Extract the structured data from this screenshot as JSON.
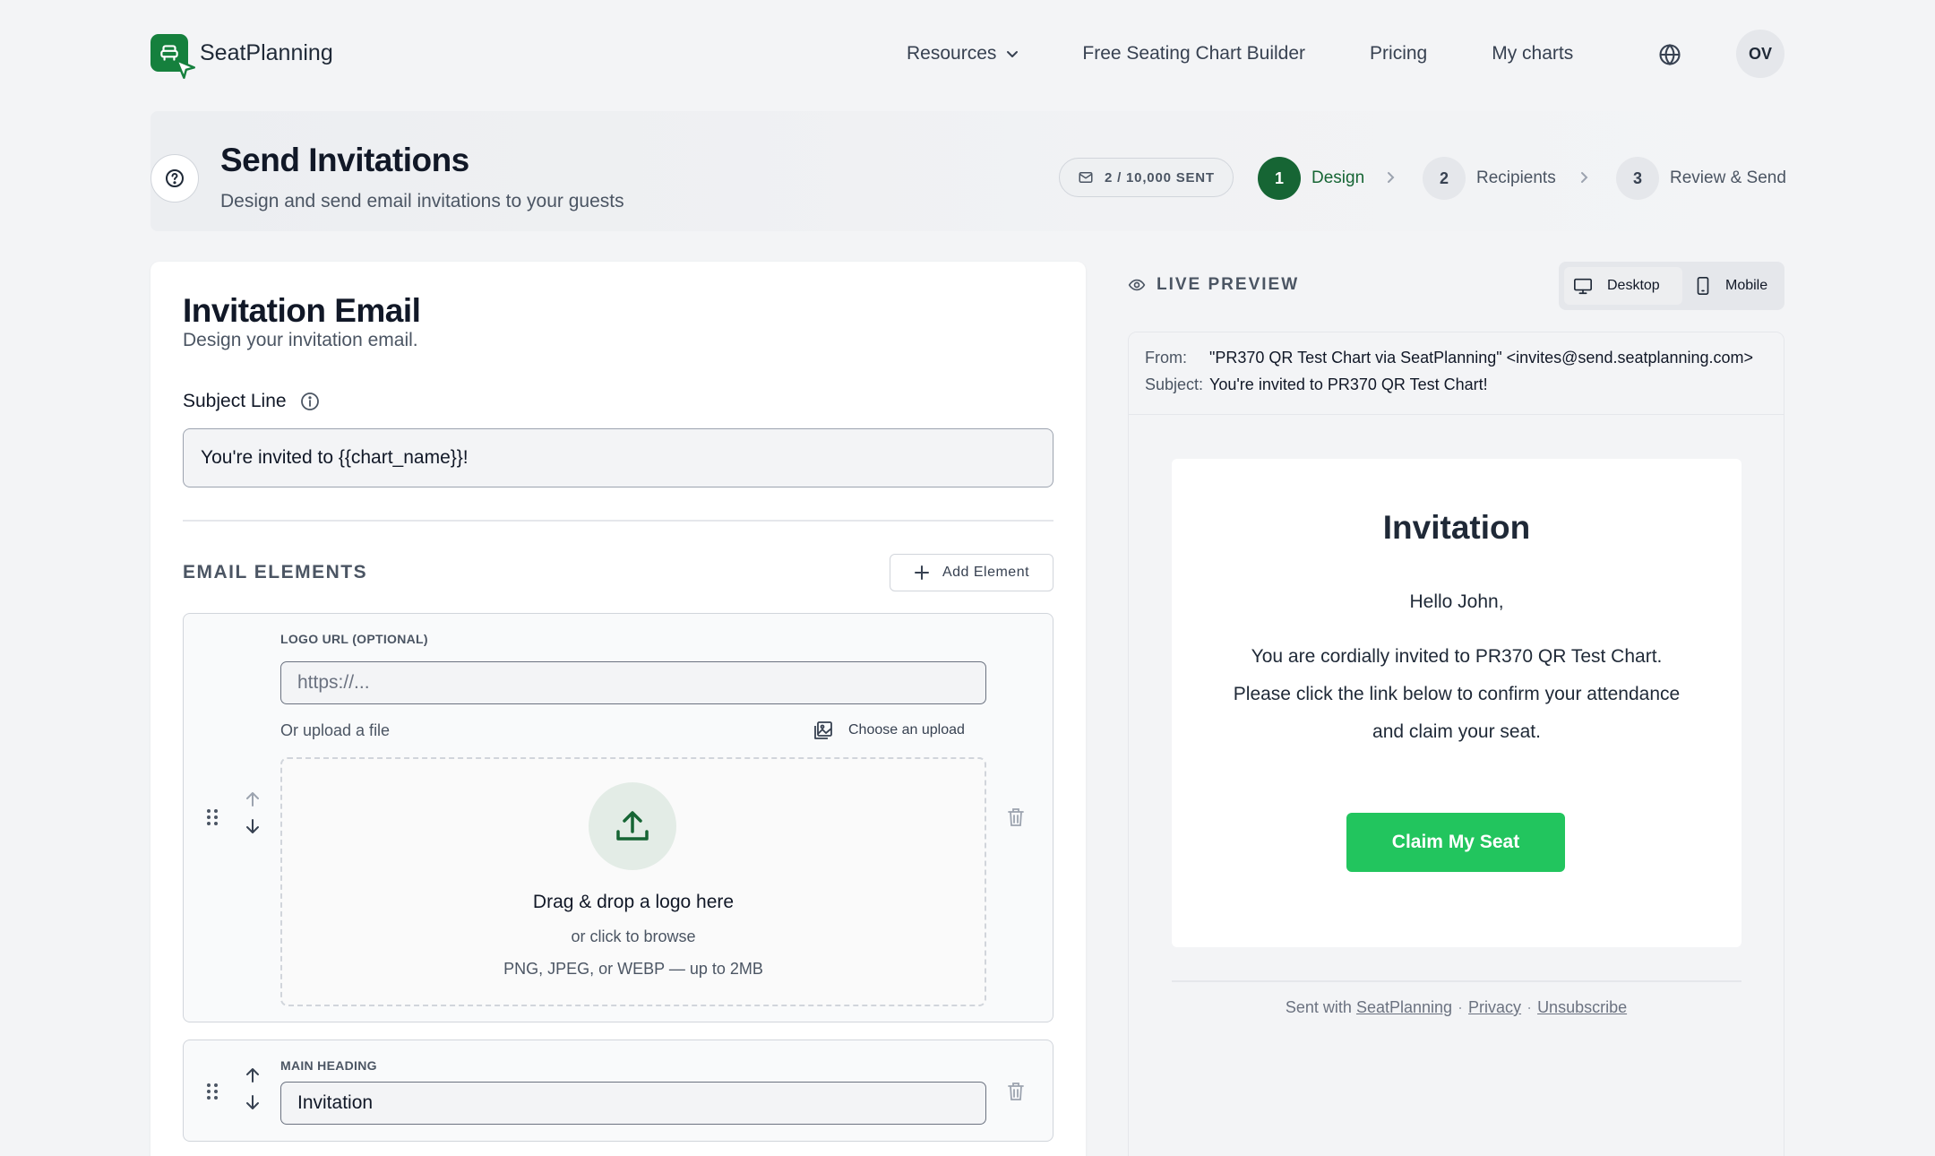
{
  "brand": {
    "name": "SeatPlanning"
  },
  "nav": {
    "items": [
      "Resources",
      "Free Seating Chart Builder",
      "Pricing",
      "My charts"
    ],
    "avatar_initials": "OV"
  },
  "header": {
    "title": "Send Invitations",
    "subtitle": "Design and send email invitations to your guests",
    "sent_count": "2 / 10,000 SENT",
    "steps": [
      {
        "num": "1",
        "label": "Design",
        "active": true
      },
      {
        "num": "2",
        "label": "Recipients",
        "active": false
      },
      {
        "num": "3",
        "label": "Review & Send",
        "active": false
      }
    ]
  },
  "editor": {
    "title": "Invitation Email",
    "subtitle": "Design your invitation email.",
    "subject_label": "Subject Line",
    "subject_value": "You're invited to {{chart_name}}!",
    "elements_title": "EMAIL ELEMENTS",
    "add_element_label": "Add Element",
    "logo": {
      "caption": "LOGO URL (OPTIONAL)",
      "placeholder": "https://...",
      "or_upload": "Or upload a file",
      "choose_upload": "Choose an upload",
      "drop_title": "Drag & drop a logo here",
      "drop_sub": "or click to browse",
      "drop_hint": "PNG, JPEG, or WEBP — up to 2MB"
    },
    "heading": {
      "caption": "MAIN HEADING",
      "value": "Invitation"
    }
  },
  "preview": {
    "label": "LIVE PREVIEW",
    "toggle": {
      "desktop": "Desktop",
      "mobile": "Mobile",
      "selected": "desktop"
    },
    "from_key": "From:",
    "from_value": "\"PR370 QR Test Chart via SeatPlanning\" <invites@send.seatplanning.com>",
    "subject_key": "Subject:",
    "subject_value": "You're invited to PR370 QR Test Chart!",
    "email": {
      "heading": "Invitation",
      "greeting": "Hello John,",
      "message": "You are cordially invited to PR370 QR Test Chart. Please click the link below to confirm your attendance and claim your seat.",
      "button": "Claim My Seat"
    },
    "footer": {
      "sent_with": "Sent with",
      "brand_link": "SeatPlanning",
      "privacy": "Privacy",
      "unsubscribe": "Unsubscribe"
    }
  },
  "colors": {
    "brand_green": "#15803d",
    "step_active": "#166534",
    "cta_green": "#22c55e"
  }
}
